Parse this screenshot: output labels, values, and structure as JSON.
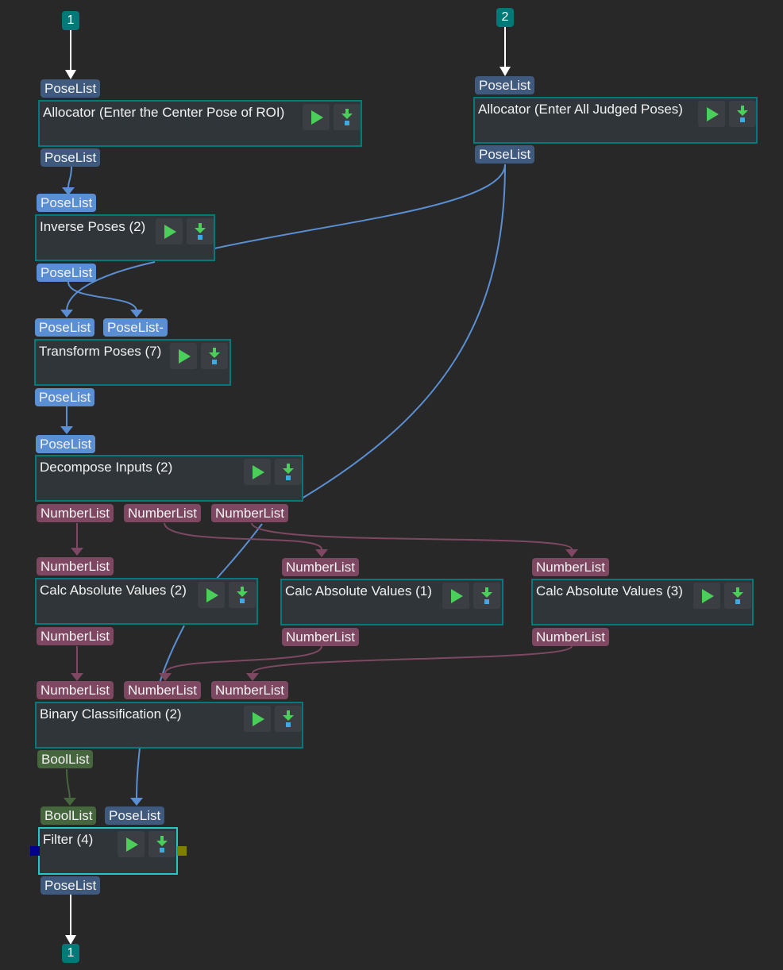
{
  "markers": {
    "in1": "1",
    "in2": "2",
    "out1": "1"
  },
  "ports": {
    "pose": "PoseList",
    "pose_minus": "PoseList-",
    "num": "NumberList",
    "bool": "BoolList"
  },
  "nodes": {
    "alloc1": {
      "title": "Allocator (Enter the Center Pose of ROI)"
    },
    "alloc2": {
      "title": "Allocator (Enter All Judged Poses)"
    },
    "inverse": {
      "title": "Inverse Poses (2)"
    },
    "transform": {
      "title": "Transform Poses (7)"
    },
    "decompose": {
      "title": "Decompose Inputs (2)"
    },
    "calc2": {
      "title": "Calc Absolute Values (2)"
    },
    "calc1": {
      "title": "Calc Absolute Values (1)"
    },
    "calc3": {
      "title": "Calc Absolute Values (3)"
    },
    "binary": {
      "title": "Binary Classification (2)"
    },
    "filter": {
      "title": "Filter (4)"
    }
  },
  "buttons": {
    "run": "run-icon",
    "step": "step-into-icon"
  },
  "colors": {
    "pose_wire": "#5a8fd3",
    "number_wire": "#7e4862",
    "bool_wire": "#46663d",
    "flow_wire": "#ffffff",
    "node_border": "#007a7a",
    "selected_border": "#25c6c6"
  }
}
